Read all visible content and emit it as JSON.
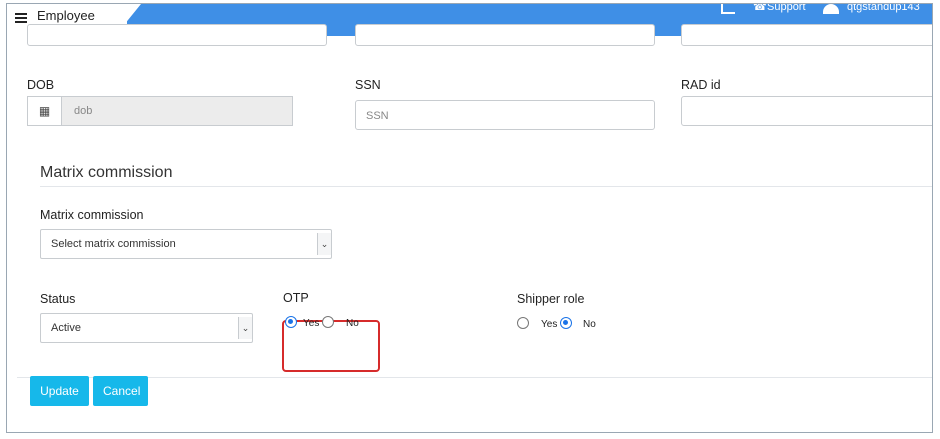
{
  "header": {
    "tab_title": "Employee",
    "support_label": "Support",
    "username": "qtgstandup143",
    "accent_color": "#3f8fe6"
  },
  "fields": {
    "dob": {
      "label": "DOB",
      "value": "dob"
    },
    "ssn": {
      "label": "SSN",
      "placeholder": "SSN"
    },
    "rad_id": {
      "label": "RAD id",
      "value": ""
    }
  },
  "matrix_section": {
    "title": "Matrix commission",
    "field_label": "Matrix commission",
    "selected": "Select matrix commission"
  },
  "status": {
    "label": "Status",
    "selected": "Active"
  },
  "otp": {
    "label": "OTP",
    "options": [
      "Yes",
      "No"
    ],
    "selected": "Yes"
  },
  "shipper_role": {
    "label": "Shipper role",
    "options": [
      "Yes",
      "No"
    ],
    "selected": "No"
  },
  "actions": {
    "update_label": "Update",
    "cancel_label": "Cancel",
    "button_color": "#16b8ea"
  },
  "icons": [
    "menu-icon",
    "chart-icon",
    "phone-icon",
    "user-icon",
    "calendar-icon",
    "chevron-down-icon"
  ]
}
